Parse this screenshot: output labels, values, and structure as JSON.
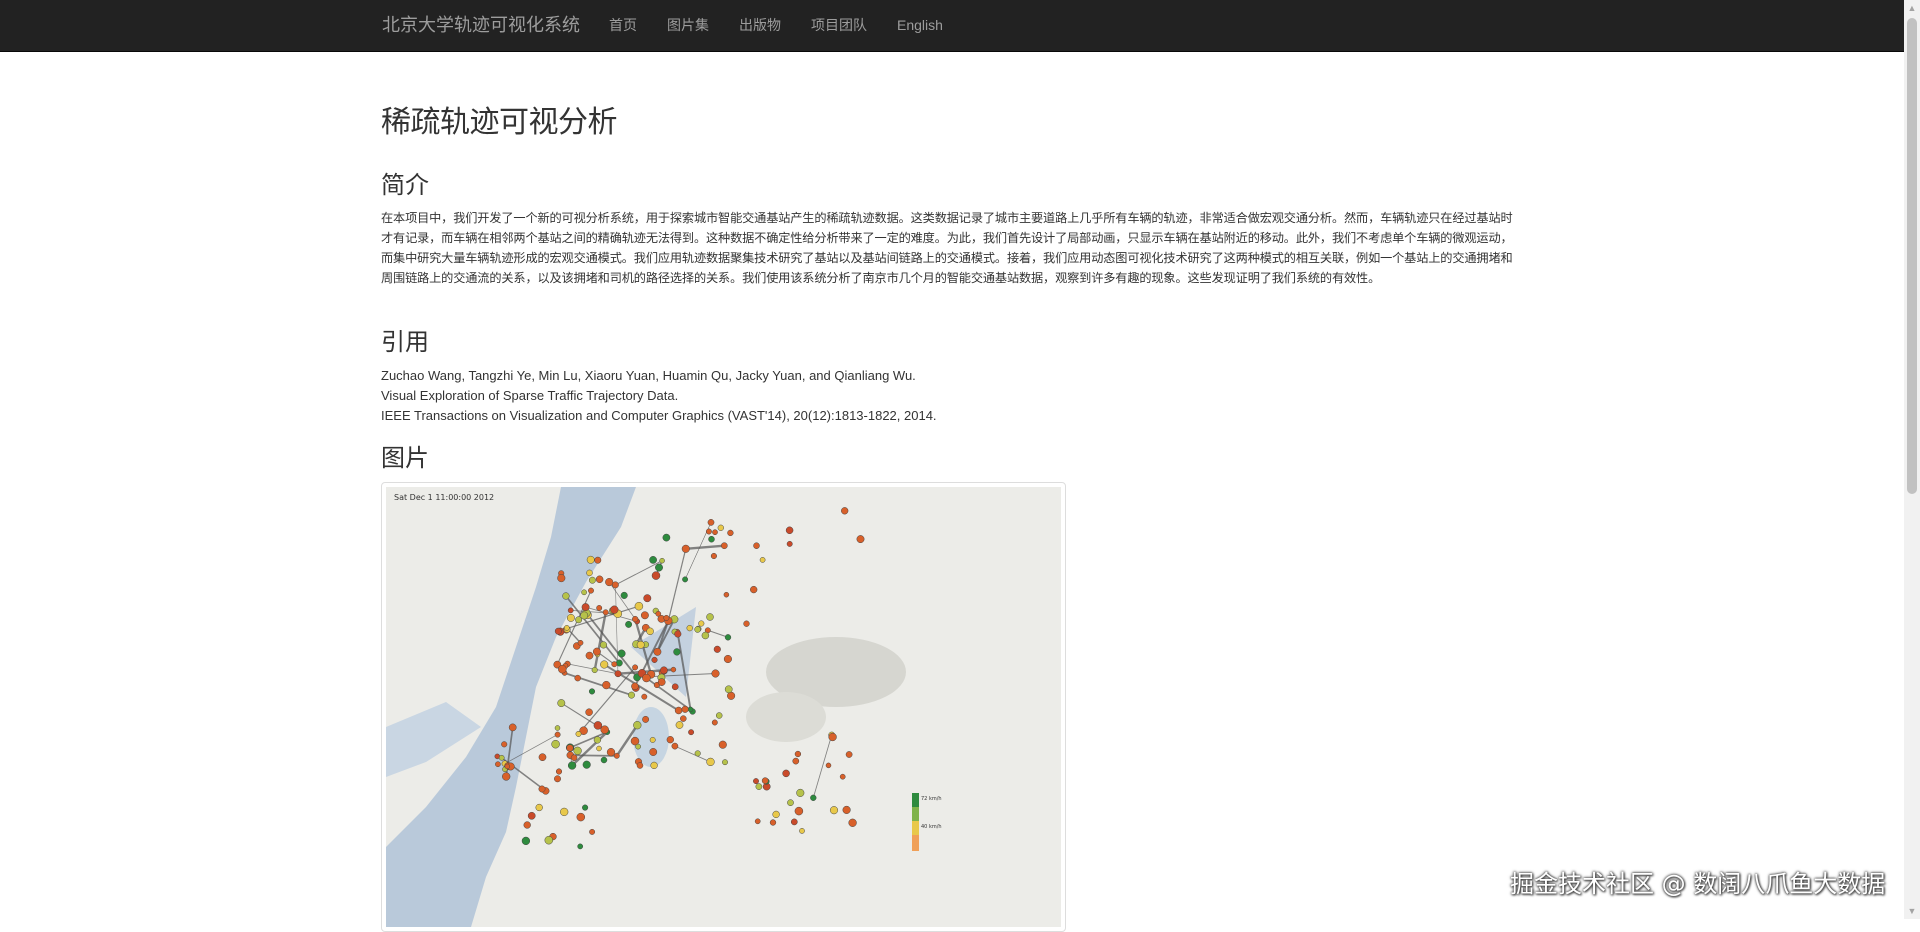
{
  "navbar": {
    "brand": "北京大学轨迹可视化系统",
    "links": [
      "首页",
      "图片集",
      "出版物",
      "项目团队",
      "English"
    ]
  },
  "page_title": "稀疏轨迹可视分析",
  "sections": {
    "intro_heading": "简介",
    "intro_text": "在本项目中，我们开发了一个新的可视分析系统，用于探索城市智能交通基站产生的稀疏轨迹数据。这类数据记录了城市主要道路上几乎所有车辆的轨迹，非常适合做宏观交通分析。然而，车辆轨迹只在经过基站时才有记录，而车辆在相邻两个基站之间的精确轨迹无法得到。这种数据不确定性给分析带来了一定的难度。为此，我们首先设计了局部动画，只显示车辆在基站附近的移动。此外，我们不考虑单个车辆的微观运动，而集中研究大量车辆轨迹形成的宏观交通模式。我们应用轨迹数据聚集技术研究了基站以及基站间链路上的交通模式。接着，我们应用动态图可视化技术研究了这两种模式的相互关联，例如一个基站上的交通拥堵和周围链路上的交通流的关系，以及该拥堵和司机的路径选择的关系。我们使用该系统分析了南京市几个月的智能交通基站数据，观察到许多有趣的现象。这些发现证明了我们系统的有效性。",
    "citation_heading": "引用",
    "citation_lines": [
      "Zuchao Wang, Tangzhi Ye, Min Lu, Xiaoru Yuan, Huamin Qu, Jacky Yuan, and Qianliang Wu.",
      "Visual Exploration of Sparse Traffic Trajectory Data.",
      "IEEE Transactions on Visualization and Computer Graphics (VAST'14), 20(12):1813-1822, 2014."
    ],
    "images_heading": "图片"
  },
  "figure": {
    "timestamp": "Sat Dec 1 11:00:00 2012",
    "legend_top": "72 km/h",
    "legend_mid": "40 km/h",
    "colors": {
      "map_bg": "#ecece8",
      "river": "#b9c9da",
      "slow": "#d8602a",
      "medium": "#e8c84a",
      "fast": "#2e8b3e"
    }
  },
  "watermark": "掘金技术社区 @ 数阔八爪鱼大数据",
  "icons": {
    "scroll_up": "triangle-up-icon",
    "scroll_down": "triangle-down-icon"
  }
}
